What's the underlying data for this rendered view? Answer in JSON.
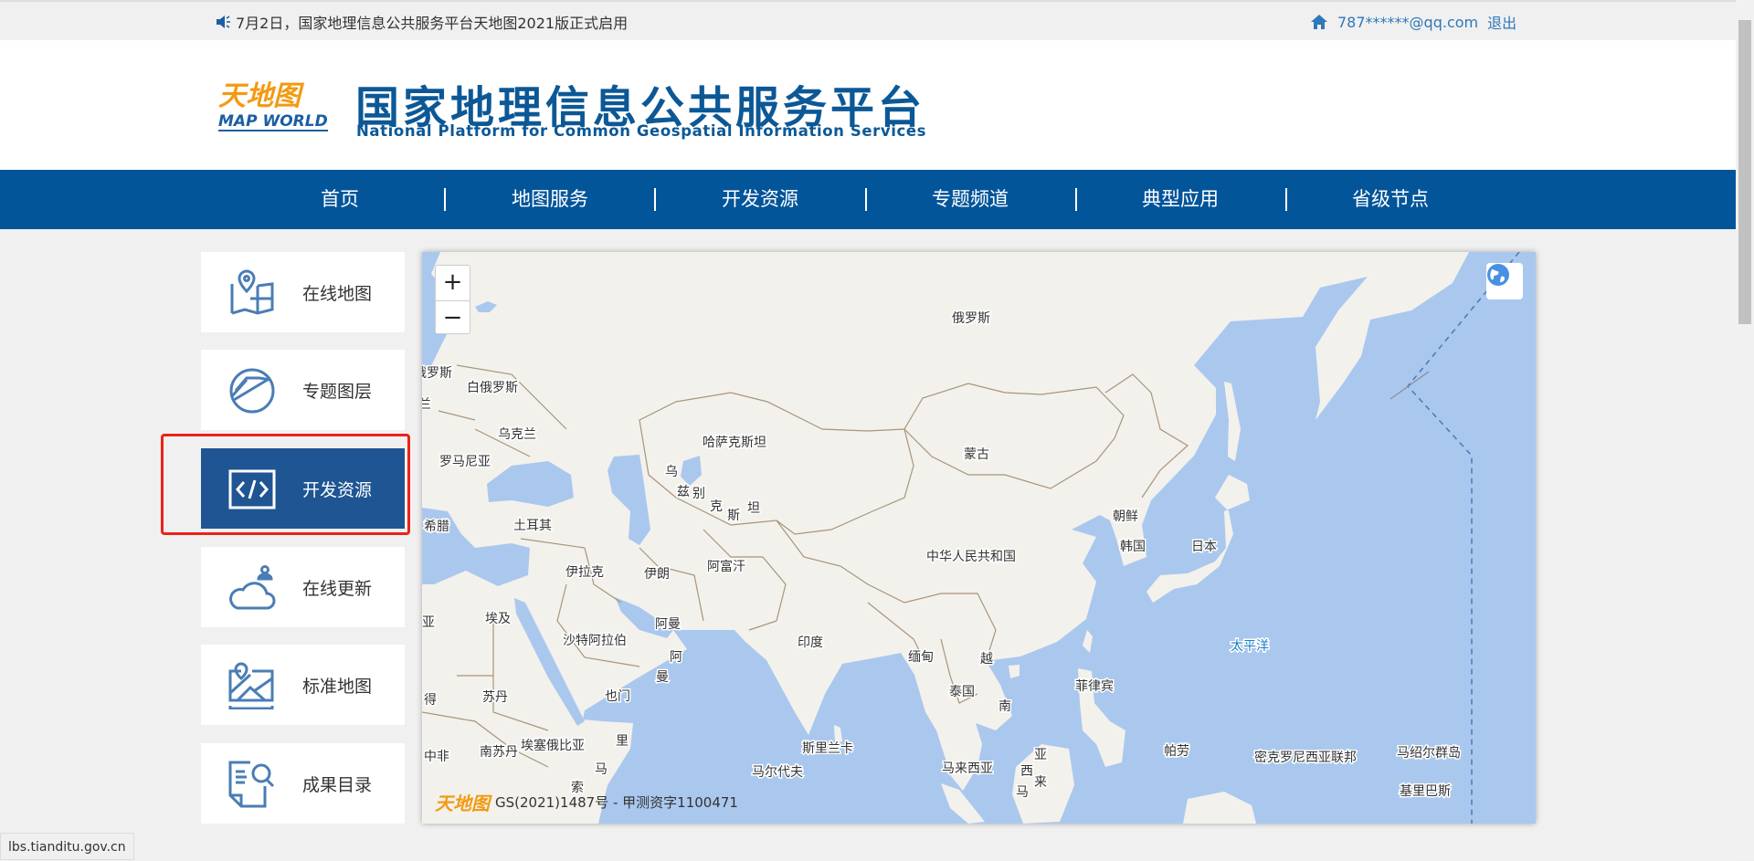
{
  "topbar": {
    "notice": "7月2日，国家地理信息公共服务平台天地图2021版正式启用",
    "user_email": "787******@qq.com",
    "logout": "退出",
    "icons": [
      "speaker-icon",
      "home-icon"
    ]
  },
  "header": {
    "logo_cn": "天地图",
    "logo_en": "MAP WORLD",
    "title_cn": "国家地理信息公共服务平台",
    "title_en": "National Platform for Common Geospatial Information Services"
  },
  "nav": {
    "items": [
      "首页",
      "地图服务",
      "开发资源",
      "专题频道",
      "典型应用",
      "省级节点"
    ]
  },
  "sidebar": {
    "items": [
      {
        "label": "在线地图",
        "icon": "map-pin-icon"
      },
      {
        "label": "专题图层",
        "icon": "layer-circle-icon"
      },
      {
        "label": "开发资源",
        "icon": "code-icon",
        "selected": true
      },
      {
        "label": "在线更新",
        "icon": "cloud-user-icon"
      },
      {
        "label": "标准地图",
        "icon": "standard-map-icon"
      },
      {
        "label": "成果目录",
        "icon": "document-search-icon"
      }
    ]
  },
  "map": {
    "zoom_in": "+",
    "zoom_out": "−",
    "attribution_logo": "天地图",
    "attribution": "GS(2021)1487号 - 甲测资字1100471",
    "labels": [
      "俄罗斯",
      "俄罗斯",
      "白俄罗斯",
      "波兰",
      "乌克兰",
      "罗马尼亚",
      "希腊",
      "土耳其",
      "哈萨克斯坦",
      "蒙古",
      "中华人民共和国",
      "朝鲜",
      "韩国",
      "日本",
      "伊拉克",
      "伊朗",
      "阿富汗",
      "亚",
      "埃及",
      "沙特阿拉伯",
      "阿曼",
      "印度",
      "缅甸",
      "越",
      "泰国",
      "南",
      "太平洋",
      "菲律宾",
      "得",
      "苏丹",
      "也门",
      "中非",
      "南苏丹",
      "埃塞俄比亚",
      "里",
      "马",
      "斯里兰卡",
      "马尔代夫",
      "马来西亚",
      "帕劳",
      "密克罗尼西亚联邦",
      "马绍尔群岛",
      "基里巴斯",
      "索"
    ],
    "uzbek_chars": [
      "乌",
      "兹",
      "别",
      "克",
      "斯",
      "坦"
    ],
    "oman_chars": [
      "阿",
      "曼"
    ],
    "malaysia_chars": [
      "亚",
      "西",
      "来",
      "马"
    ],
    "colors": {
      "land": "#f3f1ec",
      "water": "#aac8ee",
      "border": "#a8957a",
      "ocean_label": "#1a7bc4"
    }
  },
  "statusbar": {
    "url": "lbs.tianditu.gov.cn"
  },
  "colors": {
    "nav": "#03559a",
    "selected": "#1f5592",
    "highlight": "#ec2219",
    "link": "#2f78b9"
  }
}
